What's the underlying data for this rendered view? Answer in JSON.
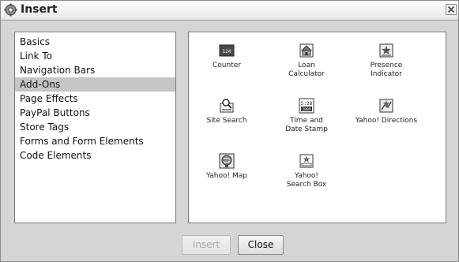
{
  "window": {
    "title": "Insert",
    "title_icon": "insert-gear-icon",
    "close_icon": "close-icon"
  },
  "categories": [
    {
      "label": "Basics",
      "selected": false
    },
    {
      "label": "Link To",
      "selected": false
    },
    {
      "label": "Navigation Bars",
      "selected": false
    },
    {
      "label": "Add-Ons",
      "selected": true
    },
    {
      "label": "Page Effects",
      "selected": false
    },
    {
      "label": "PayPal Buttons",
      "selected": false
    },
    {
      "label": "Store Tags",
      "selected": false
    },
    {
      "label": "Forms and Form Elements",
      "selected": false
    },
    {
      "label": "Code Elements",
      "selected": false
    }
  ],
  "addons": [
    {
      "label": "Counter",
      "icon": "counter-icon"
    },
    {
      "label": "Loan\nCalculator",
      "icon": "loan-calculator-icon"
    },
    {
      "label": "Presence\nIndicator",
      "icon": "presence-indicator-icon"
    },
    {
      "label": "Site Search",
      "icon": "site-search-icon"
    },
    {
      "label": "Time and\nDate Stamp",
      "icon": "time-date-stamp-icon"
    },
    {
      "label": "Yahoo! Directions",
      "icon": "yahoo-directions-icon"
    },
    {
      "label": "Yahoo! Map",
      "icon": "yahoo-map-icon"
    },
    {
      "label": "Yahoo!\nSearch Box",
      "icon": "yahoo-search-box-icon"
    }
  ],
  "icon_text": {
    "counter": "124",
    "time": "5:28",
    "date": "2009"
  },
  "buttons": {
    "insert": "Insert",
    "close": "Close"
  }
}
